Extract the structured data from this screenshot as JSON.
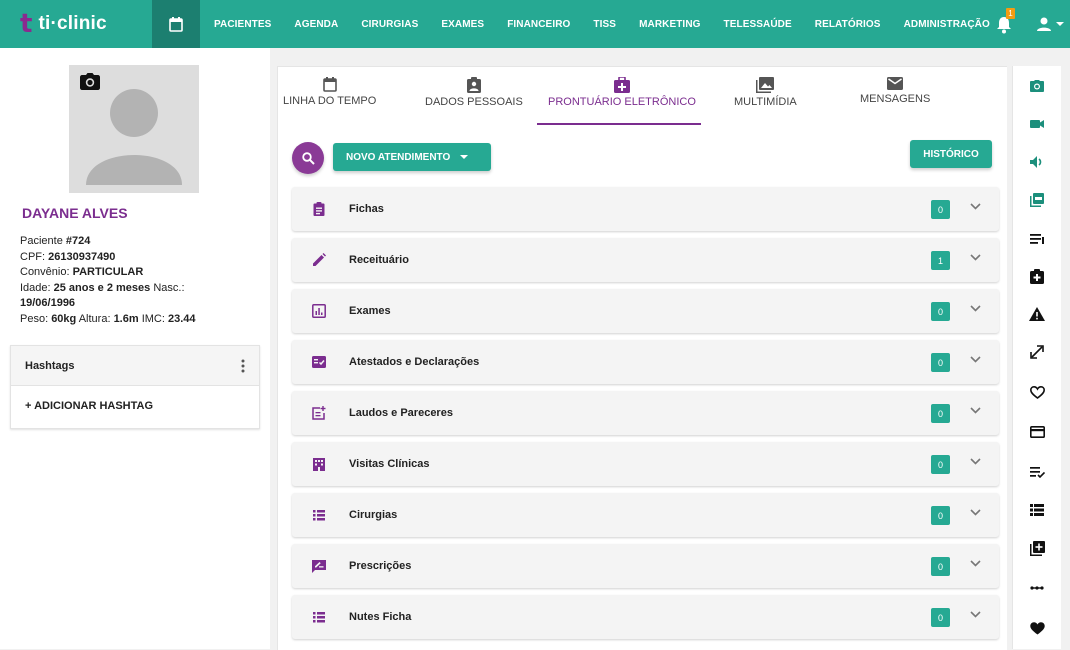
{
  "brand": {
    "mark": "t",
    "name": "ti·clinic",
    "teal": "#26a993",
    "purple": "#7b2d8f"
  },
  "nav": {
    "items": [
      "PACIENTES",
      "AGENDA",
      "CIRURGIAS",
      "EXAMES",
      "FINANCEIRO",
      "TISS",
      "MARKETING",
      "TELESSAÚDE",
      "RELATÓRIOS",
      "ADMINISTRAÇÃO"
    ]
  },
  "notifications": {
    "count": "1"
  },
  "patient": {
    "name": "DAYANE ALVES",
    "id_label": "Paciente ",
    "id": "#724",
    "cpf_label": "CPF: ",
    "cpf": "26130937490",
    "convenio_label": "Convênio: ",
    "convenio": "PARTICULAR",
    "age_label": "Idade: ",
    "age": "25 anos e 2 meses",
    "birth_label": " Nasc.:",
    "birth": "19/06/1996",
    "weight_label": "Peso: ",
    "weight": "60kg",
    "height_label": " Altura: ",
    "height": "1.6m",
    "imc_label": " IMC: ",
    "imc": "23.44"
  },
  "hashtags": {
    "title": "Hashtags",
    "add_label": "+ ADICIONAR HASHTAG"
  },
  "tabs": [
    {
      "label": "LINHA DO TEMPO",
      "icon": "calendar-icon"
    },
    {
      "label": "DADOS PESSOAIS",
      "icon": "clipboard-person-icon"
    },
    {
      "label": "PRONTUÁRIO ELETRÔNICO",
      "icon": "medical-bag-icon",
      "active": true
    },
    {
      "label": "MULTIMÍDIA",
      "icon": "photo-library-icon"
    },
    {
      "label": "MENSAGENS",
      "icon": "mail-icon"
    }
  ],
  "actions": {
    "new_label": "NOVO ATENDIMENTO",
    "history_label": "HISTÓRICO"
  },
  "sections": [
    {
      "label": "Fichas",
      "count": "0",
      "icon": "assignment-icon"
    },
    {
      "label": "Receituário",
      "count": "1",
      "icon": "pencil-icon"
    },
    {
      "label": "Exames",
      "count": "0",
      "icon": "chart-icon"
    },
    {
      "label": "Atestados e Declarações",
      "count": "0",
      "icon": "fact-check-icon"
    },
    {
      "label": "Laudos e Pareceres",
      "count": "0",
      "icon": "post-add-icon"
    },
    {
      "label": "Visitas Clínicas",
      "count": "0",
      "icon": "building-icon"
    },
    {
      "label": "Cirurgias",
      "count": "0",
      "icon": "list-icon"
    },
    {
      "label": "Prescrições",
      "count": "0",
      "icon": "rate-review-icon"
    },
    {
      "label": "Nutes Ficha",
      "count": "0",
      "icon": "list-icon"
    }
  ],
  "sidebar_tools": [
    "camera-icon",
    "videocam-icon",
    "volume-icon",
    "pdf-icon",
    "playlist-icon",
    "medical-bag-icon",
    "warning-icon",
    "expand-icon",
    "heart-outline-icon",
    "credit-card-icon",
    "playlist-check-icon",
    "view-list-icon",
    "library-add-icon",
    "more-horiz-icon",
    "heart-icon"
  ]
}
